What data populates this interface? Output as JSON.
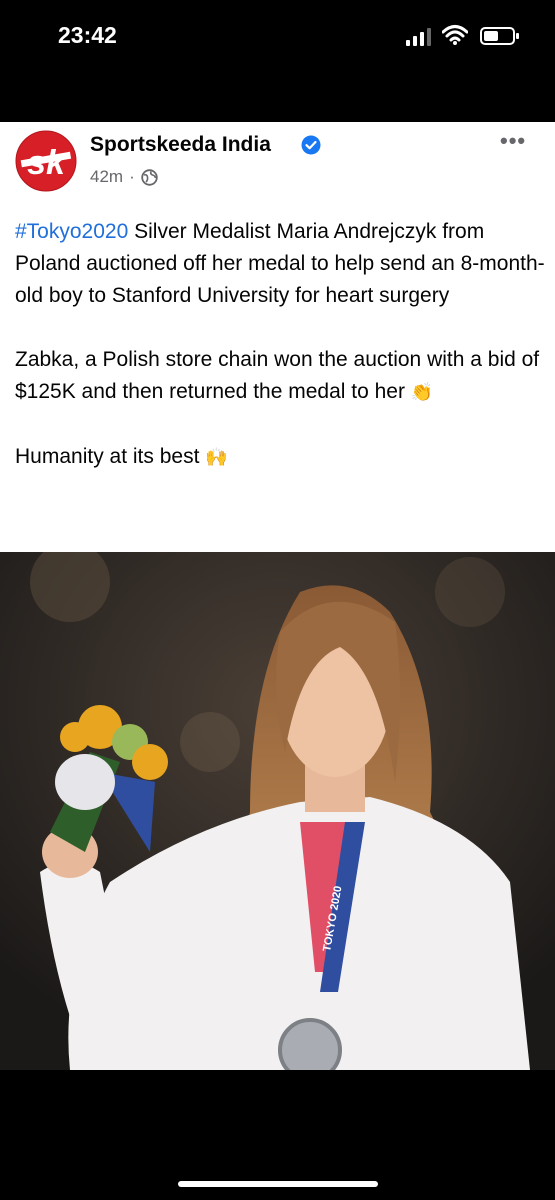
{
  "status_bar": {
    "time": "23:42"
  },
  "post": {
    "page_name": "Sportskeeda India",
    "avatar_text": "sk",
    "time_ago": "42m",
    "separator": "·",
    "more": "•••",
    "hashtag": "#Tokyo2020",
    "paragraph1": " Silver Medalist Maria Andrejczyk from Poland auctioned off her medal to help send an 8-month-old boy to Stanford University for heart surgery",
    "paragraph2": "Zabka, a Polish store chain won the auction with a bid of $125K and then returned the medal to her ",
    "paragraph2_emoji": "👏",
    "paragraph3": "Humanity at its best ",
    "paragraph3_emoji": "🙌",
    "photo_lanyard_text": "TOKYO 2020"
  },
  "colors": {
    "brand_red": "#d61f26",
    "link_blue": "#216fdb",
    "verified_blue": "#1877f2"
  }
}
